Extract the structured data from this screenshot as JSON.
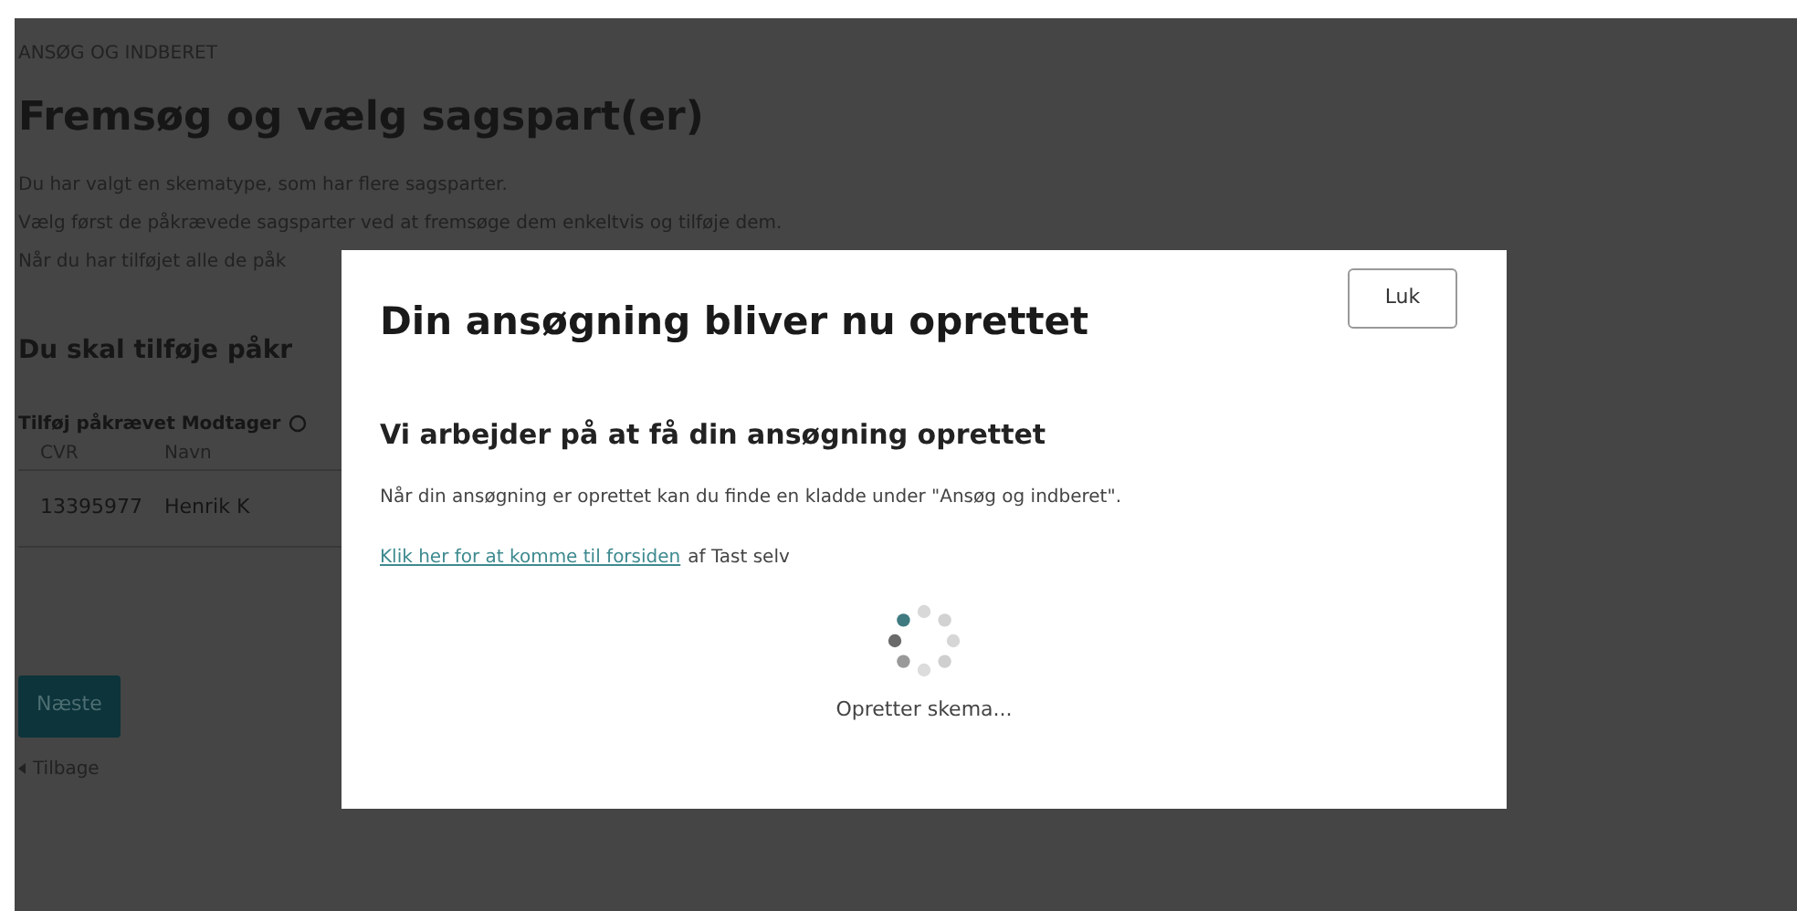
{
  "page": {
    "breadcrumb": "ANSØG OG INDBERET",
    "title": "Fremsøg og vælg sagspart(er)",
    "intro": [
      "Du har valgt en skematype, som har flere sagsparter.",
      "Vælg først de påkrævede sagsparter ved at fremsøge dem enkeltvis og tilføje dem.",
      "Når du har tilføjet alle de påk"
    ],
    "section_title": "Du skal tilføje påkr",
    "table_caption": "Tilføj påkrævet Modtager",
    "table": {
      "columns": [
        "CVR",
        "Navn"
      ],
      "rows": [
        [
          "13395977",
          "Henrik K"
        ]
      ]
    },
    "next_button": "Næste",
    "back_link": "Tilbage"
  },
  "modal": {
    "title": "Din ansøgning bliver nu oprettet",
    "close_button": "Luk",
    "subtitle": "Vi arbejder på at få din ansøgning oprettet",
    "text": "Når din ansøgning er oprettet kan du finde en kladde under \"Ansøg og indberet\".",
    "link": "Klik her for at komme til forsiden",
    "link_suffix": "af Tast selv",
    "status": "Opretter skema..."
  }
}
